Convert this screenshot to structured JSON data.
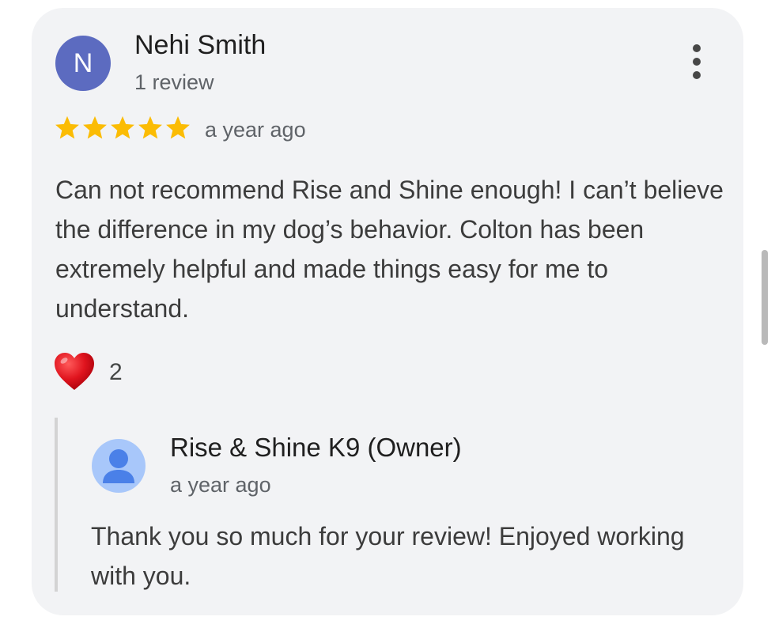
{
  "review": {
    "reviewer": {
      "initial": "N",
      "name": "Nehi Smith",
      "review_count": "1 review",
      "avatar_color": "#5c6bc0"
    },
    "menu_icon": "more-vert-icon",
    "rating": 5,
    "max_rating": 5,
    "star_color": "#fbbc04",
    "time": "a year ago",
    "text": "Can not recommend Rise and Shine enough! I can’t believe the difference in my dog’s behavior. Colton has been extremely helpful and made things easy for me to understand.",
    "reaction": {
      "icon": "heart-icon",
      "count": "2"
    }
  },
  "owner_reply": {
    "avatar_icon": "person-icon",
    "avatar_bg": "#a8c7fa",
    "avatar_fg": "#4a80e8",
    "name": "Rise & Shine K9 (Owner)",
    "time": "a year ago",
    "text": "Thank you so much for your review! Enjoyed working with you."
  }
}
